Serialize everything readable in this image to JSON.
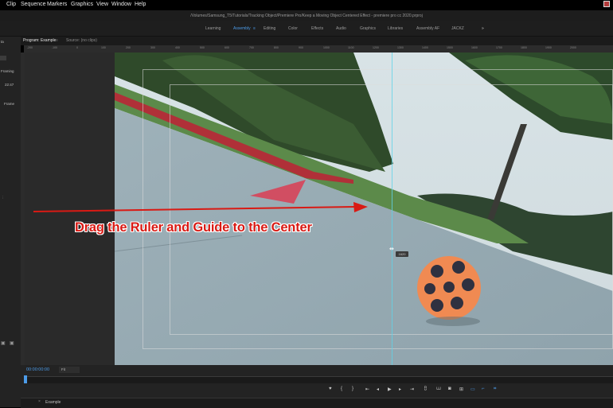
{
  "menu": [
    "Clip",
    "Sequence",
    "Markers",
    "Graphics",
    "View",
    "Window",
    "Help"
  ],
  "title": "/Volumes/Samsung_T5/Tutorials/Tracking Object/Premiere Pro/Keep a Moving Object Centered Effect - premiere pro cc 2020.prproj",
  "workspaces": [
    "Learning",
    "Assembly",
    "Editing",
    "Color",
    "Effects",
    "Audio",
    "Graphics",
    "Libraries",
    "Assembly AF",
    "JACKZ"
  ],
  "active_workspace": "Assembly",
  "workspace_overflow": "»",
  "left_panel": {
    "label1": "ta",
    "label2": "Framing",
    "label3": "Frame",
    "label4": "22:47"
  },
  "tabs": {
    "program": "Program: Example",
    "source": "Source: (no clips)"
  },
  "ruler_ticks": [
    "-200",
    "-100",
    "0",
    "100",
    "200",
    "300",
    "400",
    "500",
    "600",
    "700",
    "800",
    "900",
    "1000",
    "1100",
    "1200",
    "1300",
    "1400",
    "1500",
    "1600",
    "1700",
    "1800",
    "1900",
    "2000"
  ],
  "tooltip": "1620",
  "annotation": "Drag the Ruler and Guide to the Center",
  "timecode": "00:00:00:00",
  "fit": "Fit",
  "sequence_tab": "Example",
  "colors": {
    "accent": "#4c9be8",
    "annotation": "#d91a14",
    "guide": "#5fd3e8"
  },
  "icons": [
    "marker-icon",
    "in-point-icon",
    "out-point-icon",
    "go-to-in-icon",
    "step-back-icon",
    "play-icon",
    "step-forward-icon",
    "go-to-out-icon",
    "lift-icon",
    "extract-icon",
    "export-frame-icon",
    "compare-icon",
    "ruler-icon",
    "guides-icon",
    "snap-icon"
  ]
}
